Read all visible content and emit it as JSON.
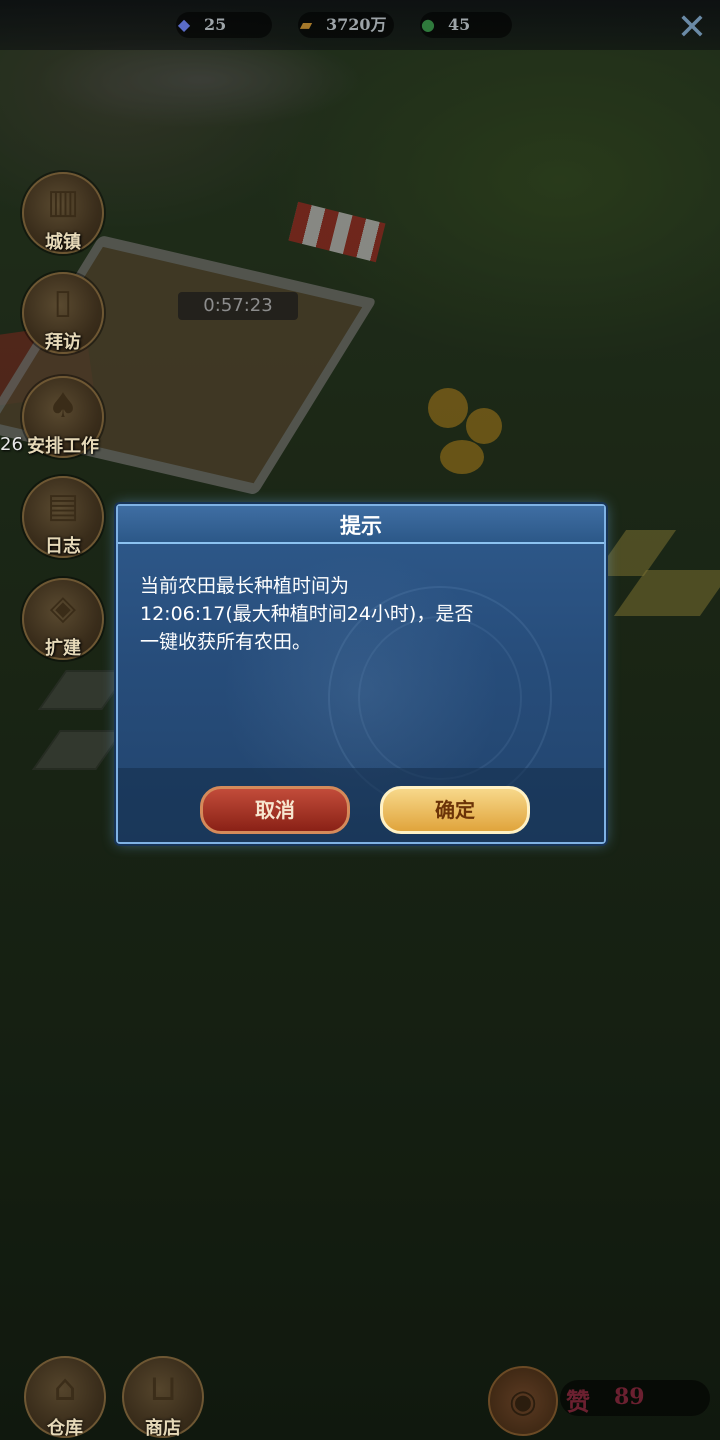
{
  "topbar": {
    "diamonds": "25",
    "gold": "3720万",
    "exp": "45",
    "close_icon": "close-icon",
    "diamond_icon": "diamond-icon",
    "gold_icon": "gold-bars-icon",
    "exp_icon": "exp-gem-icon"
  },
  "farm": {
    "timer": "0:57:23"
  },
  "left_menu": [
    {
      "label": "城镇",
      "icon": "town-hall-icon"
    },
    {
      "label": "拜访",
      "icon": "door-icon"
    },
    {
      "label": "安排工作",
      "icon": "shovel-icon",
      "badge": "26"
    },
    {
      "label": "日志",
      "icon": "clipboard-icon"
    },
    {
      "label": "扩建",
      "icon": "expand-tiles-icon"
    }
  ],
  "dialog": {
    "title": "提示",
    "message_line1": "当前农田最长种植时间为",
    "message_line2": "12:06:17(最大种植时间24小时)，是否",
    "message_line3": "一键收获所有农田。",
    "cancel": "取消",
    "confirm": "确定"
  },
  "bottom": {
    "warehouse": "仓库",
    "shop": "商店",
    "like_label": "赞",
    "like_count": "89",
    "warehouse_icon": "warehouse-icon",
    "shop_icon": "cart-icon",
    "camera_icon": "camera-icon"
  },
  "colors": {
    "dialog_bg": "#274d7b",
    "dialog_border": "#7fb2e4",
    "cancel_button": "#a8301f",
    "confirm_button": "#eab85a"
  }
}
